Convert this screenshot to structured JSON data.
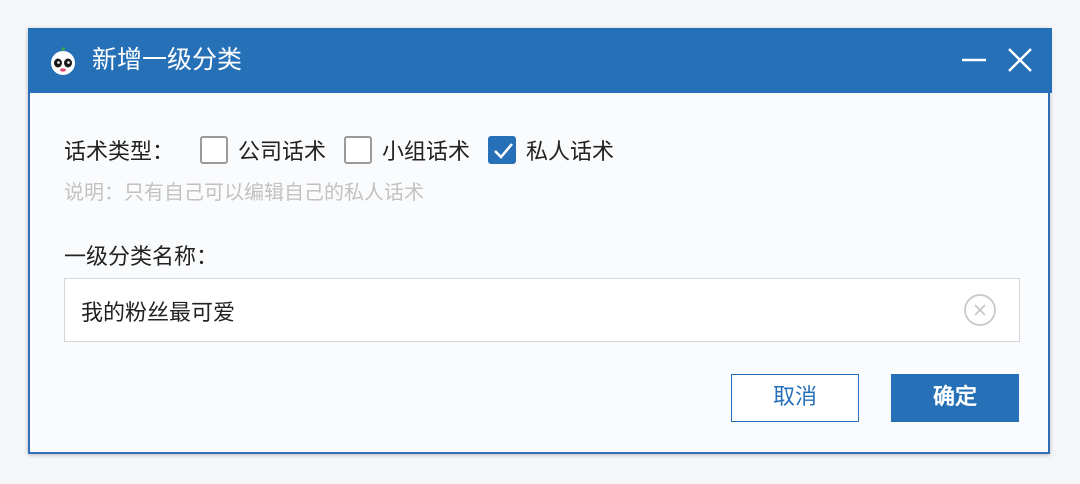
{
  "window": {
    "title": "新增一级分类",
    "logo_icon": "panda-logo-icon",
    "minimize_icon": "minimize-icon",
    "close_icon": "close-icon"
  },
  "form": {
    "type_label": "话术类型：",
    "options": [
      {
        "label": "公司话术",
        "checked": false
      },
      {
        "label": "小组话术",
        "checked": false
      },
      {
        "label": "私人话术",
        "checked": true
      }
    ],
    "hint": "说明：只有自己可以编辑自己的私人话术",
    "name_label": "一级分类名称：",
    "name_value": "我的粉丝最可爱",
    "clear_icon": "clear-circle-icon"
  },
  "actions": {
    "cancel_label": "取消",
    "ok_label": "确定"
  },
  "colors": {
    "primary": "#2670b8",
    "hint_text": "#c2c2c2"
  }
}
